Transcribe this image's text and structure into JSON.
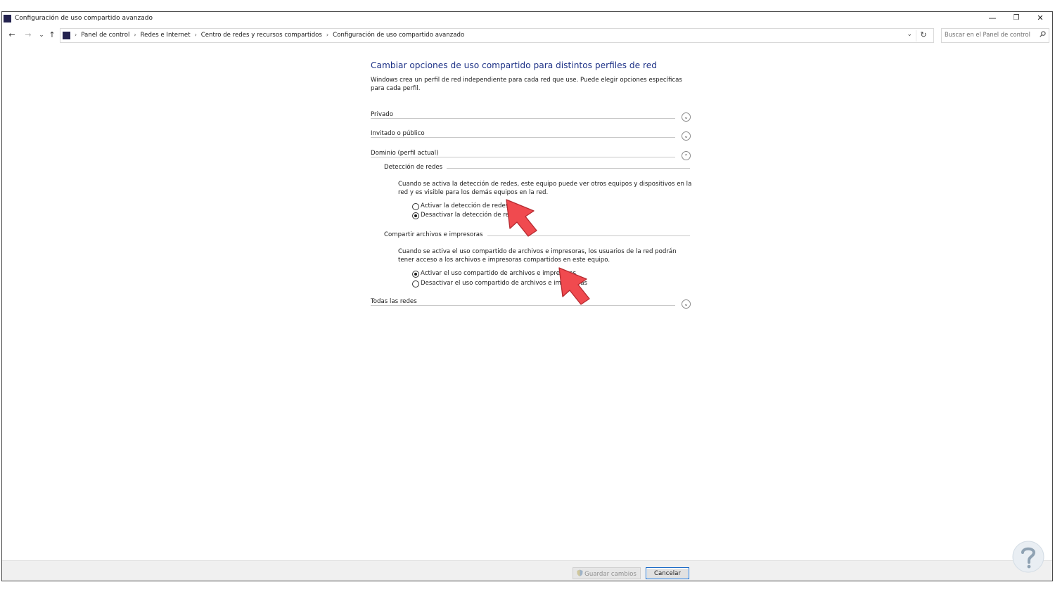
{
  "window": {
    "title": "Configuración de uso compartido avanzado"
  },
  "window_controls": {
    "minimize": "—",
    "maximize": "❐",
    "close": "✕"
  },
  "nav": {
    "back": "←",
    "forward": "→",
    "recent": "⌄",
    "up": "↑"
  },
  "breadcrumb": {
    "root_sep": "›",
    "items": [
      {
        "label": "Panel de control",
        "sep": "›"
      },
      {
        "label": "Redes e Internet",
        "sep": "›"
      },
      {
        "label": "Centro de redes y recursos compartidos",
        "sep": "›"
      },
      {
        "label": "Configuración de uso compartido avanzado"
      }
    ],
    "dropdown": "⌄",
    "refresh": "↻"
  },
  "search": {
    "placeholder": "Buscar en el Panel de control",
    "icon": "search-icon"
  },
  "main": {
    "heading": "Cambiar opciones de uso compartido para distintos perfiles de red",
    "intro": "Windows crea un perfil de red independiente para cada red que use. Puede elegir opciones específicas para cada perfil.",
    "profiles": [
      {
        "label": "Privado",
        "expanded": false
      },
      {
        "label": "Invitado o público",
        "expanded": false
      },
      {
        "label": "Dominio (perfil actual)",
        "expanded": true
      },
      {
        "label": "Todas las redes",
        "expanded": false
      }
    ],
    "domain": {
      "network_discovery": {
        "title": "Detección de redes",
        "description": "Cuando se activa la detección de redes, este equipo puede ver otros equipos y dispositivos en la red y es visible para los demás equipos en la red.",
        "options": [
          {
            "label": "Activar la detección de redes",
            "checked": false
          },
          {
            "label": "Desactivar la detección de redes",
            "checked": true
          }
        ]
      },
      "file_printer_sharing": {
        "title": "Compartir archivos e impresoras",
        "description": "Cuando se activa el uso compartido de archivos e impresoras, los usuarios de la red podrán tener acceso a los archivos e impresoras compartidos en este equipo.",
        "options": [
          {
            "label": "Activar el uso compartido de archivos e impresoras",
            "checked": true
          },
          {
            "label": "Desactivar el uso compartido de archivos e impresoras",
            "checked": false
          }
        ]
      }
    },
    "chevron_down": "⌄",
    "chevron_up": "⌃"
  },
  "footer": {
    "save_label": "Guardar cambios",
    "cancel_label": "Cancelar"
  },
  "colors": {
    "heading": "#1e3287",
    "annotation_arrow": "#f04a4f",
    "app_icon": "#23224e"
  }
}
